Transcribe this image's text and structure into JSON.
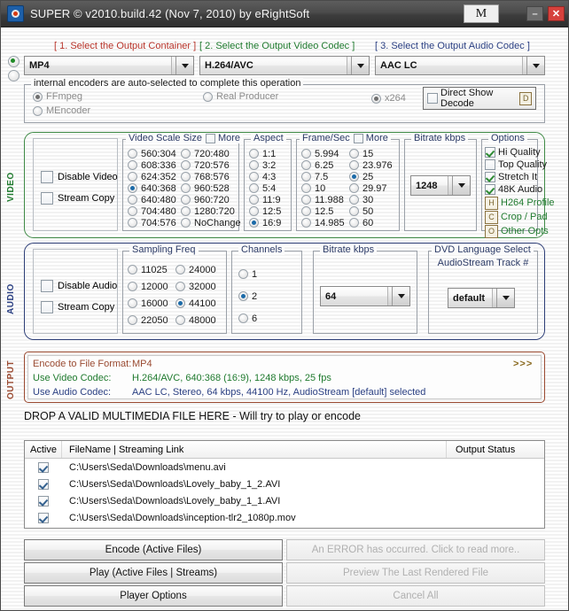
{
  "window": {
    "title": "SUPER © v2010.build.42 (Nov 7, 2010) by eRightSoft",
    "m_button": "M",
    "minimize": "–",
    "close": "✕"
  },
  "selectors": {
    "container": {
      "header": "[ 1.          Select the Output Container ]",
      "value": "MP4"
    },
    "video_codec": {
      "header": "[ 2.       Select the Output Video Codec ]",
      "value": "H.264/AVC"
    },
    "audio_codec": {
      "header": "[ 3.       Select the Output Audio Codec ]",
      "value": "AAC LC"
    }
  },
  "encoders": {
    "title": "internal encoders are auto-selected to complete this operation",
    "options": [
      {
        "label": "FFmpeg",
        "selected": true
      },
      {
        "label": "MEncoder",
        "selected": false
      },
      {
        "label": "Real Producer",
        "selected": false
      },
      {
        "label": "x264",
        "selected": true
      }
    ],
    "directshow": {
      "label": "Direct Show Decode",
      "badge": "D",
      "checked": false
    }
  },
  "video": {
    "section_label": "VIDEO",
    "disable_video": {
      "label": "Disable Video",
      "checked": false
    },
    "stream_copy": {
      "label": "Stream Copy",
      "checked": false
    },
    "scale_size": {
      "title": "Video Scale Size",
      "more_label": "More",
      "more_checked": false,
      "col1": [
        "560:304",
        "608:336",
        "624:352",
        "640:368",
        "640:480",
        "704:480",
        "704:576"
      ],
      "col2": [
        "720:480",
        "720:576",
        "768:576",
        "960:528",
        "960:720",
        "1280:720",
        "NoChange"
      ],
      "selected": "640:368"
    },
    "aspect": {
      "title": "Aspect",
      "options": [
        "1:1",
        "3:2",
        "4:3",
        "5:4",
        "11:9",
        "12:5",
        "16:9"
      ],
      "selected": "16:9"
    },
    "framerate": {
      "title": "Frame/Sec",
      "more_label": "More",
      "more_checked": false,
      "col1": [
        "5.994",
        "6.25",
        "7.5",
        "10",
        "11.988",
        "12.5",
        "14.985"
      ],
      "col2": [
        "15",
        "23.976",
        "25",
        "29.97",
        "30",
        "50",
        "60"
      ],
      "selected": "25"
    },
    "bitrate": {
      "title": "Bitrate  kbps",
      "value": "1248"
    },
    "options": {
      "title": "Options",
      "checks": [
        {
          "label": "Hi Quality",
          "checked": true
        },
        {
          "label": "Top Quality",
          "checked": false
        },
        {
          "label": "Stretch It",
          "checked": true
        },
        {
          "label": "48K Audio",
          "checked": true
        }
      ],
      "buttons": [
        {
          "badge": "H",
          "label": "H264 Profile"
        },
        {
          "badge": "C",
          "label": "Crop / Pad"
        },
        {
          "badge": "O",
          "label": "Other Opts"
        }
      ]
    }
  },
  "audio": {
    "section_label": "AUDIO",
    "disable_audio": {
      "label": "Disable Audio",
      "checked": false
    },
    "stream_copy": {
      "label": "Stream Copy",
      "checked": false
    },
    "sampling": {
      "title": "Sampling Freq",
      "col1": [
        "11025",
        "12000",
        "16000",
        "22050"
      ],
      "col2": [
        "24000",
        "32000",
        "44100",
        "48000"
      ],
      "selected": "44100"
    },
    "channels": {
      "title": "Channels",
      "options": [
        "1",
        "2",
        "6"
      ],
      "selected": "2"
    },
    "bitrate": {
      "title": "Bitrate  kbps",
      "value": "64"
    },
    "dvd_language": {
      "title_line1": "DVD Language Select",
      "title_line2": "AudioStream  Track #",
      "value": "default"
    }
  },
  "output": {
    "section_label": "OUTPUT",
    "more_indicator": ">>>",
    "rows": [
      {
        "label": "Encode to File Format:",
        "value": "MP4"
      },
      {
        "label": "Use Video Codec:",
        "value": "H.264/AVC,  640:368 (16:9),  1248 kbps,  25 fps"
      },
      {
        "label": "Use Audio Codec:",
        "value": "AAC LC,  Stereo,  64 kbps,  44100 Hz,  AudioStream [default] selected"
      }
    ],
    "drop_hint": "DROP A VALID MULTIMEDIA FILE HERE - Will try to play or encode"
  },
  "filelist": {
    "columns": [
      "Active",
      "FileName  |  Streaming Link",
      "Output Status"
    ],
    "rows": [
      {
        "active": true,
        "filename": "C:\\Users\\Seda\\Downloads\\menu.avi",
        "status": ""
      },
      {
        "active": true,
        "filename": "C:\\Users\\Seda\\Downloads\\Lovely_baby_1_2.AVI",
        "status": ""
      },
      {
        "active": true,
        "filename": "C:\\Users\\Seda\\Downloads\\Lovely_baby_1_1.AVI",
        "status": ""
      },
      {
        "active": true,
        "filename": "C:\\Users\\Seda\\Downloads\\inception-tlr2_1080p.mov",
        "status": ""
      }
    ]
  },
  "actions": {
    "encode": {
      "label": "Encode (Active Files)",
      "enabled": true
    },
    "play": {
      "label": "Play (Active Files | Streams)",
      "enabled": true
    },
    "player_options": {
      "label": "Player Options",
      "enabled": true
    },
    "error": {
      "label": "An ERROR has occurred. Click to read more..",
      "enabled": false
    },
    "preview": {
      "label": "Preview The Last Rendered File",
      "enabled": false
    },
    "cancel": {
      "label": "Cancel All",
      "enabled": false
    }
  },
  "colors": {
    "container_header": "#b8342a",
    "video_header": "#1f7a2e",
    "audio_header": "#2a3f82",
    "video_border": "#3f8a46",
    "audio_border": "#2d3e77",
    "output_border": "#9a4a31",
    "more_indicator": "#8a6a20"
  }
}
